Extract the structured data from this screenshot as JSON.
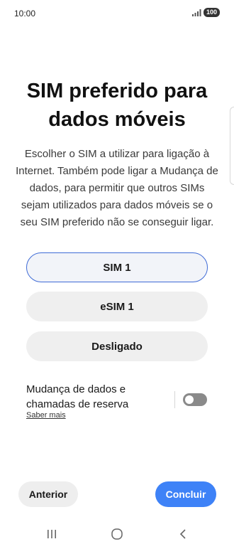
{
  "status_bar": {
    "time": "10:00",
    "battery": "100"
  },
  "title": "SIM preferido para dados móveis",
  "description": "Escolher o SIM a utilizar para ligação à Internet. Também pode ligar a Mudança de dados, para permitir que outros SIMs sejam utilizados para dados móveis se o seu SIM preferido não se conseguir ligar.",
  "options": [
    {
      "label": "SIM 1",
      "selected": true
    },
    {
      "label": "eSIM 1",
      "selected": false
    },
    {
      "label": "Desligado",
      "selected": false
    }
  ],
  "backup": {
    "label": "Mudança de dados e chamadas de reserva",
    "learn_more": "Saber mais",
    "enabled": false
  },
  "footer": {
    "previous_label": "Anterior",
    "done_label": "Concluir"
  },
  "colors": {
    "accent": "#3e82f7",
    "selected_border": "#3f6bd6"
  },
  "icons": {
    "nav_recent": "recent-apps-icon",
    "nav_home": "home-icon",
    "nav_back": "back-icon"
  }
}
